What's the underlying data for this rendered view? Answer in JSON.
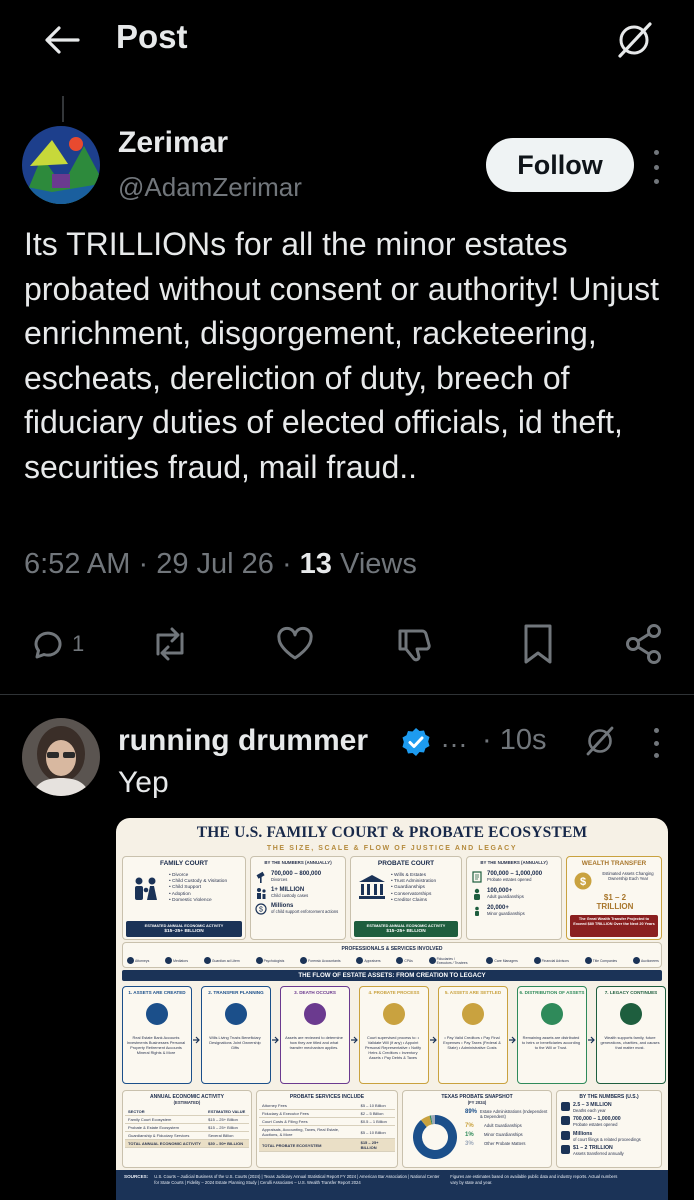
{
  "header": {
    "title": "Post"
  },
  "post": {
    "author_name": "Zerimar",
    "author_handle": "@AdamZerimar",
    "follow_label": "Follow",
    "text": "Its TRILLIONs for all the minor estates probated without consent or authority! Unjust enrichment, disgorgement, racketeering, escheats, dereliction of duty, breech of fiduciary duties of elected officials, id theft, securities fraud, mail fraud..",
    "time": "6:52 AM",
    "date": "29 Jul 26",
    "views_count": "13",
    "views_label": "Views",
    "reply_count": "1"
  },
  "reply": {
    "author_name": "running drummer",
    "ellipsis": "…",
    "time": "10s",
    "text": "Yep"
  },
  "infographic": {
    "title": "THE U.S. FAMILY COURT & PROBATE ECOSYSTEM",
    "subtitle": "THE SIZE, SCALE & FLOW OF JUSTICE AND LEGACY",
    "family_court": {
      "heading": "FAMILY COURT",
      "items": [
        "• Divorce",
        "• Child Custody & Visitation",
        "• Child Support",
        "• Adoption",
        "• Domestic Violence"
      ],
      "band_label": "ESTIMATED ANNUAL ECONOMIC ACTIVITY",
      "band_value": "$15–25+ BILLION"
    },
    "numbers_1": {
      "heading": "BY THE NUMBERS (ANNUALLY)",
      "rows": [
        {
          "value": "700,000 – 800,000",
          "label": "Divorces"
        },
        {
          "value": "1+ MILLION",
          "label": "Child custody cases"
        },
        {
          "value": "Millions",
          "label": "of child support enforcement actions"
        }
      ]
    },
    "probate_court": {
      "heading": "PROBATE COURT",
      "items": [
        "• Wills & Estates",
        "• Trust Administration",
        "• Guardianships",
        "• Conservatorships",
        "• Creditor Claims"
      ],
      "band_label": "ESTIMATED ANNUAL ECONOMIC ACTIVITY",
      "band_value": "$15–25+ BILLION"
    },
    "numbers_2": {
      "heading": "BY THE NUMBERS (ANNUALLY)",
      "rows": [
        {
          "value": "700,000 – 1,000,000",
          "label": "Probate estates opened"
        },
        {
          "value": "100,000+",
          "label": "Adult guardianships"
        },
        {
          "value": "20,000+",
          "label": "Minor guardianships"
        }
      ]
    },
    "wealth": {
      "heading": "WEALTH TRANSFER",
      "desc": "Estimated Assets Changing Ownership Each Year",
      "value_line1": "$1 – 2",
      "value_line2": "TRILLION",
      "band": "The Great Wealth Transfer Projected to Exceed $80 TRILLION Over the Next 20 Years"
    },
    "pros_heading": "PROFESSIONALS & SERVICES INVOLVED",
    "pros": [
      "Attorneys",
      "Mediators",
      "Guardian ad Litem",
      "Psychologists",
      "Forensic Accountants",
      "Appraisers",
      "CPAs",
      "Fiduciaries / Executors / Trustees",
      "Care Managers",
      "Financial Advisors",
      "Title Companies",
      "Auctioneers"
    ],
    "flow_heading": "THE FLOW OF ESTATE ASSETS: FROM CREATION TO LEGACY",
    "steps": [
      {
        "title": "1. ASSETS ARE CREATED",
        "body": "Real Estate Bank Accounts Investments Businesses Personal Property Retirement Accounts Mineral Rights & More"
      },
      {
        "title": "2. TRANSFER PLANNING",
        "body": "Wills Living Trusts Beneficiary Designations Joint Ownership Gifts"
      },
      {
        "title": "3. DEATH OCCURS",
        "body": "Assets are reviewed to determine how they are titled and what transfer mechanism applies."
      },
      {
        "title": "4. PROBATE PROCESS",
        "body": "Court supervised process to: • Validate Will (if any) • Appoint Personal Representative • Notify Heirs & Creditors • Inventory Assets • Pay Debts & Taxes"
      },
      {
        "title": "5. ASSETS ARE SETTLED",
        "body": "• Pay Valid Creditors • Pay Final Expenses • Pay Taxes (Federal & State) • Administrative Costs"
      },
      {
        "title": "6. DISTRIBUTION OF ASSETS",
        "body": "Remaining assets are distributed to heirs or beneficiaries according to the Will or Trust."
      },
      {
        "title": "7. LEGACY CONTINUES",
        "body": "Wealth supports family, future generations, charities, and causes that matter most."
      }
    ],
    "activity": {
      "heading": "ANNUAL ECONOMIC ACTIVITY",
      "subheading": "(ESTIMATED)",
      "col1": "SECTOR",
      "col2": "ESTIMATED VALUE",
      "rows": [
        {
          "sector": "Family Court Ecosystem",
          "value": "$15 – 25+ Billion"
        },
        {
          "sector": "Probate & Estate Ecosystem",
          "value": "$15 – 25+ Billion"
        },
        {
          "sector": "Guardianship & Fiduciary Services",
          "value": "Several Billion"
        }
      ],
      "total_label": "TOTAL ANNUAL ECONOMIC ACTIVITY",
      "total_value": "$30 – 50+ BILLION"
    },
    "probate_services": {
      "heading": "PROBATE SERVICES INCLUDE",
      "rows": [
        {
          "label": "Attorney Fees",
          "value": "$5 – 10 Billion"
        },
        {
          "label": "Fiduciary & Executor Fees",
          "value": "$2 – 5 Billion"
        },
        {
          "label": "Court Costs & Filing Fees",
          "value": "$0.5 – 1 Billion"
        },
        {
          "label": "Appraisals, Accounting, Taxes, Real Estate, Auctions, & More",
          "value": "$5 – 10 Billion"
        }
      ],
      "total_label": "TOTAL PROBATE ECOSYSTEM",
      "total_value": "$15 – 25+ BILLION"
    },
    "texas": {
      "heading": "TEXAS PROBATE SNAPSHOT",
      "subheading": "(FY 2024)",
      "slices": [
        {
          "pct": "89%",
          "label": "Estate Administrations (Independent & Dependent)",
          "color": "#1b4f8a"
        },
        {
          "pct": "7%",
          "label": "Adult Guardianships",
          "color": "#c9a23f"
        },
        {
          "pct": "1%",
          "label": "Minor Guardianships",
          "color": "#2f8a5a"
        },
        {
          "pct": "3%",
          "label": "Other Probate Matters",
          "color": "#9aa6b8"
        }
      ]
    },
    "numbers_us": {
      "heading": "BY THE NUMBERS (U.S.)",
      "rows": [
        {
          "value": "2.5 – 3 MILLION",
          "label": "Deaths each year"
        },
        {
          "value": "700,000 – 1,000,000",
          "label": "Probate estates opened"
        },
        {
          "value": "Millions",
          "label": "of court filings & related proceedings"
        },
        {
          "value": "$1 – 2 TRILLION",
          "label": "Assets transferred annually"
        }
      ]
    },
    "sources_label": "SOURCES:",
    "sources_text": "U.S. Courts – Judicial Business of the U.S. Courts (2024) | Texas Judiciary Annual Statistical Report FY 2024 | American Bar Association | National Center for State Courts | Fidelity – 2024 Estate Planning Study | Cerulli Associates – U.S. Wealth Transfer Report 2024",
    "sources_note": "Figures are estimates based on available public data and industry reports. Actual numbers vary by state and year."
  }
}
